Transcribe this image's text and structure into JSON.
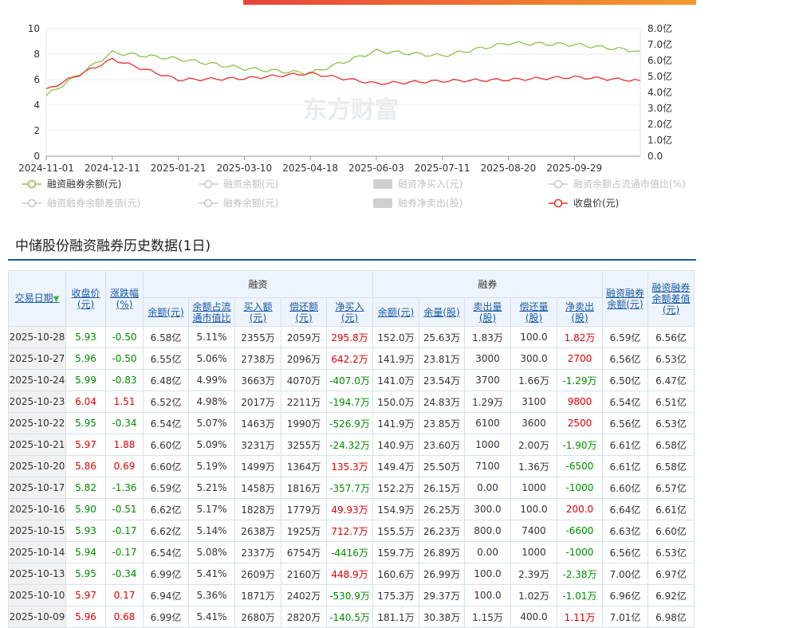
{
  "chart": {
    "watermark": "东方财富",
    "left_axis_ticks": [
      "10",
      "8",
      "6",
      "4",
      "2",
      "0"
    ],
    "right_axis_ticks": [
      "8.0亿",
      "7.0亿",
      "6.0亿",
      "5.0亿",
      "4.0亿",
      "3.0亿",
      "2.0亿",
      "1.0亿",
      "0.0"
    ],
    "x_ticks": [
      "2024-11-01",
      "2024-12-11",
      "2025-01-21",
      "2025-03-10",
      "2025-04-18",
      "2025-06-03",
      "2025-07-11",
      "2025-08-20",
      "2025-09-29"
    ],
    "legend": [
      {
        "label": "融资融券余额(元)",
        "color": "#8bc34a",
        "active": true
      },
      {
        "label": "融资余额(元)",
        "color": "#c8c8c8",
        "active": false
      },
      {
        "label": "融资净买入(元)",
        "color": "#c8c8c8",
        "active": false,
        "box": true
      },
      {
        "label": "融资余额占流通市值比(%)",
        "color": "#c8c8c8",
        "active": false
      },
      {
        "label": "融资融券余额差值(元)",
        "color": "#c8c8c8",
        "active": false
      },
      {
        "label": "融券余额(元)",
        "color": "#c8c8c8",
        "active": false
      },
      {
        "label": "融券净卖出(股)",
        "color": "#c8c8c8",
        "active": false,
        "box": true
      },
      {
        "label": "收盘价(元)",
        "color": "#e8302a",
        "active": true
      }
    ]
  },
  "chart_data": {
    "type": "line",
    "x": [
      "2024-11-01",
      "2024-12-11",
      "2025-01-21",
      "2025-03-10",
      "2025-04-18",
      "2025-06-03",
      "2025-07-11",
      "2025-08-20",
      "2025-09-29",
      "2025-10-28"
    ],
    "series": [
      {
        "name": "融资融券余额(元)",
        "axis": "right",
        "unit": "亿",
        "color": "#8bc34a",
        "values": [
          3.8,
          6.5,
          6.1,
          5.5,
          5.2,
          6.6,
          6.3,
          7.1,
          7.0,
          6.6
        ]
      },
      {
        "name": "收盘价(元)",
        "axis": "left",
        "color": "#e8302a",
        "values": [
          5.2,
          7.6,
          6.0,
          6.1,
          6.5,
          5.7,
          5.9,
          6.0,
          6.2,
          5.93
        ]
      }
    ],
    "left_ylim": [
      0,
      10
    ],
    "right_ylim": [
      0,
      8
    ],
    "grid": true,
    "legend_position": "bottom"
  },
  "section_title": "中储股份融资融券历史数据(1日)",
  "table": {
    "headers": {
      "date": "交易日期",
      "close": "收盘价\n(元)",
      "change": "涨跌幅\n(%)",
      "rz_group": "融资",
      "rq_group": "融券",
      "rz_balance": "余额(元)",
      "rz_ratio": "余额占流\n通市值比",
      "rz_buy": "买入额\n(元)",
      "rz_repay": "偿还额\n(元)",
      "rz_net": "净买入\n(元)",
      "rq_balance": "余额(元)",
      "rq_volume": "余量(股)",
      "rq_sell": "卖出量\n(股)",
      "rq_repay": "偿还量\n(股)",
      "rq_net": "净卖出\n(股)",
      "total": "融资融券\n余额(元)",
      "diff": "融资融券\n余额差值\n(元)"
    },
    "rows": [
      [
        "2025-10-28",
        "5.93",
        "-0.50",
        "6.58亿",
        "5.11%",
        "2355万",
        "2059万",
        "295.8万",
        "152.0万",
        "25.63万",
        "1.83万",
        "100.0",
        "1.82万",
        "6.59亿",
        "6.56亿"
      ],
      [
        "2025-10-27",
        "5.96",
        "-0.50",
        "6.55亿",
        "5.06%",
        "2738万",
        "2096万",
        "642.2万",
        "141.9万",
        "23.81万",
        "3000",
        "300.0",
        "2700",
        "6.56亿",
        "6.53亿"
      ],
      [
        "2025-10-24",
        "5.99",
        "-0.83",
        "6.48亿",
        "4.99%",
        "3663万",
        "4070万",
        "-407.0万",
        "141.0万",
        "23.54万",
        "3700",
        "1.66万",
        "-1.29万",
        "6.50亿",
        "6.47亿"
      ],
      [
        "2025-10-23",
        "6.04",
        "1.51",
        "6.52亿",
        "4.98%",
        "2017万",
        "2211万",
        "-194.7万",
        "150.0万",
        "24.83万",
        "1.29万",
        "3100",
        "9800",
        "6.54亿",
        "6.51亿"
      ],
      [
        "2025-10-22",
        "5.95",
        "-0.34",
        "6.54亿",
        "5.07%",
        "1463万",
        "1990万",
        "-526.9万",
        "141.9万",
        "23.85万",
        "6100",
        "3600",
        "2500",
        "6.56亿",
        "6.53亿"
      ],
      [
        "2025-10-21",
        "5.97",
        "1.88",
        "6.60亿",
        "5.09%",
        "3231万",
        "3255万",
        "-24.32万",
        "140.9万",
        "23.60万",
        "1000",
        "2.00万",
        "-1.90万",
        "6.61亿",
        "6.58亿"
      ],
      [
        "2025-10-20",
        "5.86",
        "0.69",
        "6.60亿",
        "5.19%",
        "1499万",
        "1364万",
        "135.3万",
        "149.4万",
        "25.50万",
        "7100",
        "1.36万",
        "-6500",
        "6.61亿",
        "6.58亿"
      ],
      [
        "2025-10-17",
        "5.82",
        "-1.36",
        "6.59亿",
        "5.21%",
        "1458万",
        "1816万",
        "-357.7万",
        "152.2万",
        "26.15万",
        "0.00",
        "1000",
        "-1000",
        "6.60亿",
        "6.57亿"
      ],
      [
        "2025-10-16",
        "5.90",
        "-0.51",
        "6.62亿",
        "5.17%",
        "1828万",
        "1779万",
        "49.93万",
        "154.9万",
        "26.25万",
        "300.0",
        "100.0",
        "200.0",
        "6.64亿",
        "6.61亿"
      ],
      [
        "2025-10-15",
        "5.93",
        "-0.17",
        "6.62亿",
        "5.14%",
        "2638万",
        "1925万",
        "712.7万",
        "155.5万",
        "26.23万",
        "800.0",
        "7400",
        "-6600",
        "6.63亿",
        "6.60亿"
      ],
      [
        "2025-10-14",
        "5.94",
        "-0.17",
        "6.54亿",
        "5.08%",
        "2337万",
        "6754万",
        "-4416万",
        "159.7万",
        "26.89万",
        "0.00",
        "1000",
        "-1000",
        "6.56亿",
        "6.53亿"
      ],
      [
        "2025-10-13",
        "5.95",
        "-0.34",
        "6.99亿",
        "5.41%",
        "2609万",
        "2160万",
        "448.9万",
        "160.6万",
        "26.99万",
        "100.0",
        "2.39万",
        "-2.38万",
        "7.00亿",
        "6.97亿"
      ],
      [
        "2025-10-10",
        "5.97",
        "0.17",
        "6.94亿",
        "5.36%",
        "1871万",
        "2402万",
        "-530.9万",
        "175.3万",
        "29.37万",
        "100.0",
        "1.02万",
        "-1.01万",
        "6.96亿",
        "6.92亿"
      ],
      [
        "2025-10-09",
        "5.96",
        "0.68",
        "6.99亿",
        "5.41%",
        "2680万",
        "2820万",
        "-140.5万",
        "181.1万",
        "30.38万",
        "1.15万",
        "400.0",
        "1.11万",
        "7.01亿",
        "6.98亿"
      ]
    ]
  }
}
